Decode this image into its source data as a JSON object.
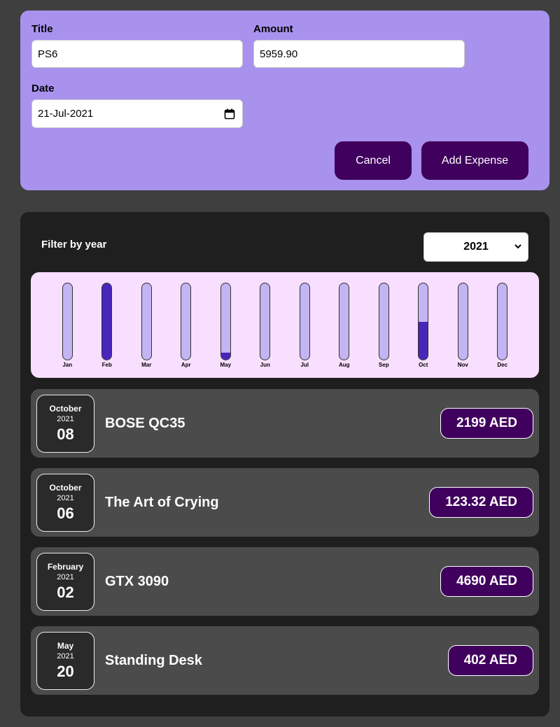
{
  "form": {
    "title_label": "Title",
    "title_value": "PS6",
    "amount_label": "Amount",
    "amount_value": "5959.90",
    "date_label": "Date",
    "date_value": "21-Jul-2021",
    "cancel_label": "Cancel",
    "submit_label": "Add Expense"
  },
  "filter": {
    "label": "Filter by year",
    "selected_year": "2021"
  },
  "chart_data": {
    "type": "bar",
    "categories": [
      "Jan",
      "Feb",
      "Mar",
      "Apr",
      "May",
      "Jun",
      "Jul",
      "Aug",
      "Sep",
      "Oct",
      "Nov",
      "Dec"
    ],
    "values": [
      0,
      4690,
      0,
      0,
      402,
      0,
      0,
      0,
      0,
      2322.32,
      0,
      0
    ],
    "max": 4690
  },
  "expenses": [
    {
      "month": "October",
      "year": "2021",
      "day": "08",
      "title": "BOSE QC35",
      "amount": "2199 AED"
    },
    {
      "month": "October",
      "year": "2021",
      "day": "06",
      "title": "The Art of Crying",
      "amount": "123.32 AED"
    },
    {
      "month": "February",
      "year": "2021",
      "day": "02",
      "title": "GTX 3090",
      "amount": "4690 AED"
    },
    {
      "month": "May",
      "year": "2021",
      "day": "20",
      "title": "Standing Desk",
      "amount": "402 AED"
    }
  ],
  "colors": {
    "form_bg": "#a892ee",
    "button": "#40005d",
    "bar_fill": "#4826b9",
    "bar_track": "#c3b4f3",
    "chart_bg": "#f8dfff"
  }
}
